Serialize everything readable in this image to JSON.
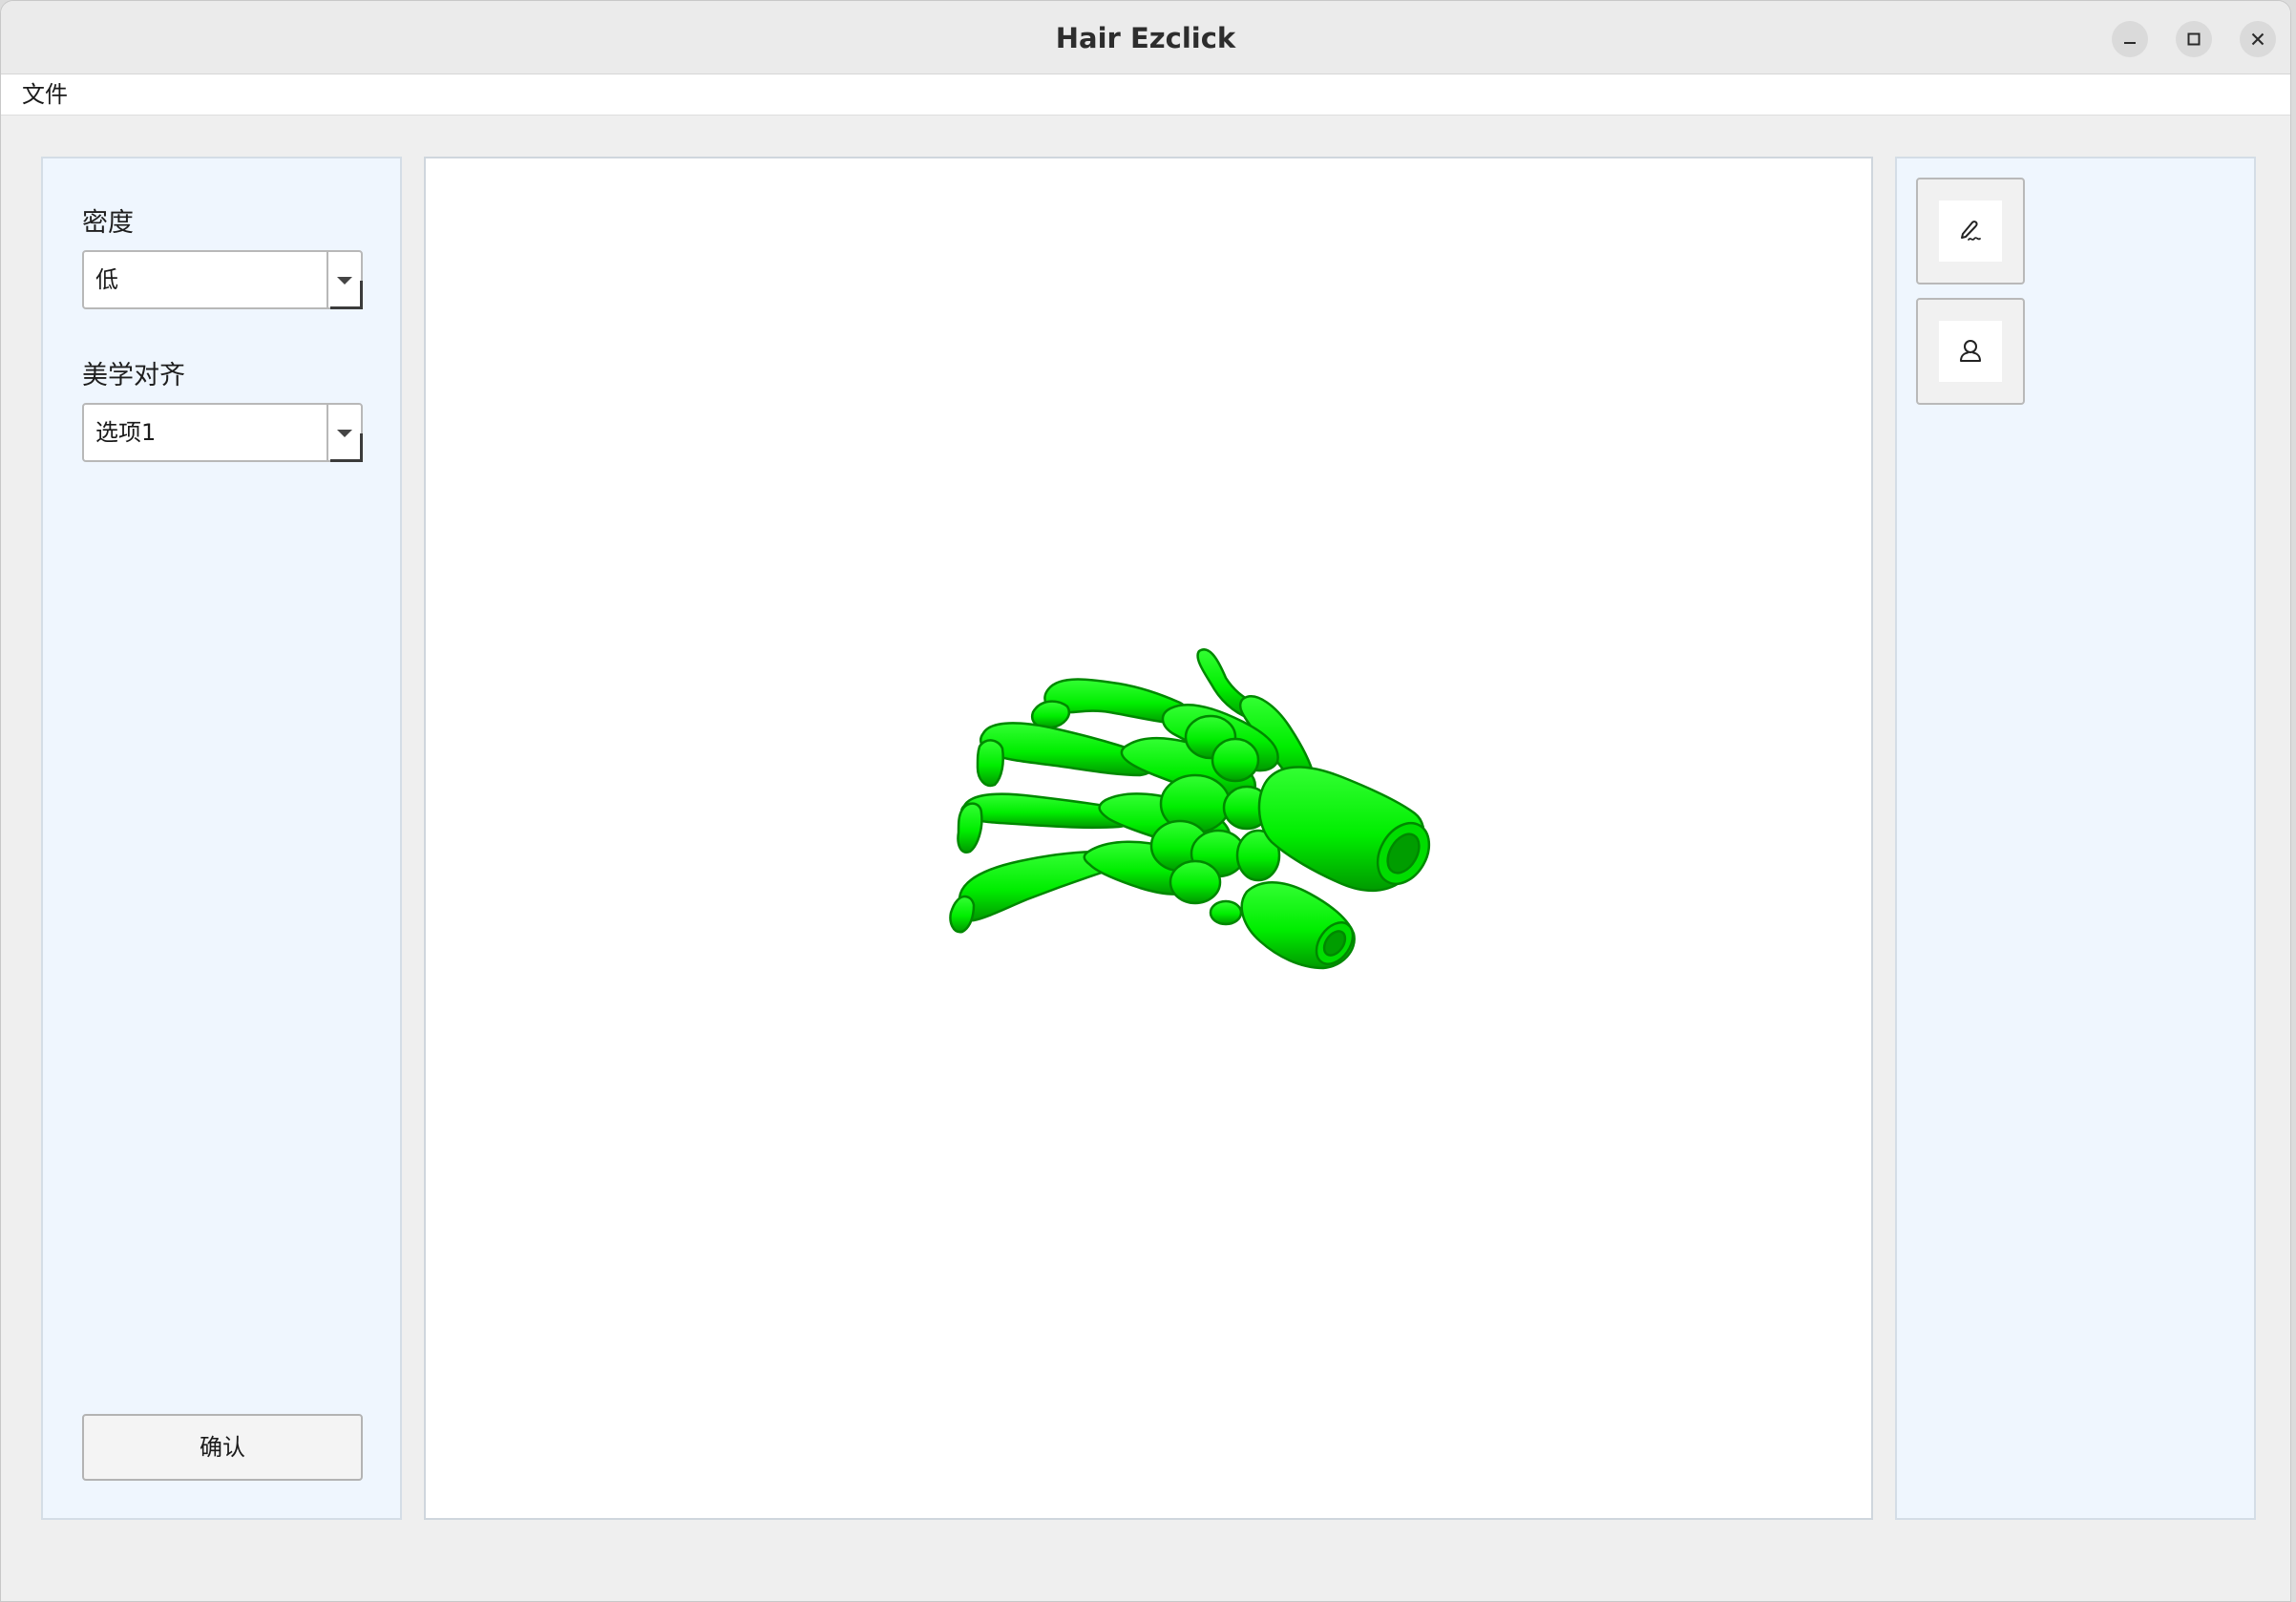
{
  "window": {
    "title": "Hair Ezclick"
  },
  "menubar": {
    "items": [
      {
        "label": "文件"
      }
    ]
  },
  "left_panel": {
    "density": {
      "label": "密度",
      "selected": "低"
    },
    "alignment": {
      "label": "美学对齐",
      "selected": "选项1"
    },
    "confirm_label": "确认"
  },
  "right_panel": {
    "tools": [
      {
        "icon": "pen-signature-icon"
      },
      {
        "icon": "user-outline-icon"
      }
    ]
  },
  "viewport": {
    "model": "hand-skeleton-3d",
    "model_color": "#00ff00"
  },
  "colors": {
    "panel_bg": "#eff6fe",
    "viewport_bg": "#ffffff",
    "window_bg": "#efefef"
  }
}
